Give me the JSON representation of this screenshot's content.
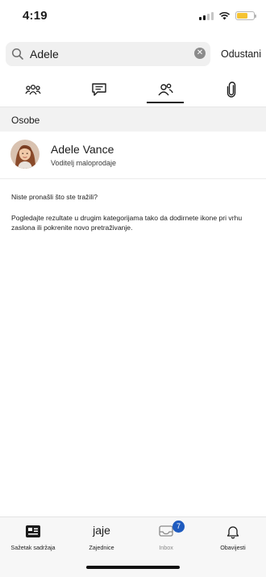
{
  "status_bar": {
    "time": "4:19"
  },
  "search": {
    "query": "Adele",
    "cancel_label": "Odustani"
  },
  "tabs": [
    {
      "icon": "people-group-icon",
      "selected": false
    },
    {
      "icon": "chat-icon",
      "selected": false
    },
    {
      "icon": "people-icon",
      "selected": true
    },
    {
      "icon": "paperclip-icon",
      "selected": false
    }
  ],
  "section": {
    "header": "Osobe"
  },
  "results": [
    {
      "name": "Adele Vance",
      "title": "Voditelj maloprodaje"
    }
  ],
  "empty_hint": {
    "question": "Niste pronašli što ste tražili?",
    "text": "Pogledajte rezultate u drugim kategorijama tako da dodirnete ikone pri vrhu zaslona ili pokrenite novo pretraživanje."
  },
  "bottom_nav": {
    "items": [
      {
        "label": "Sažetak sadržaja",
        "icon": "news-feed-icon"
      },
      {
        "label": "Zajednice",
        "icon_text": "jaje"
      },
      {
        "label": "Inbox",
        "icon": "inbox-icon",
        "badge": "7"
      },
      {
        "label": "Obavijesti",
        "icon": "bell-icon"
      }
    ]
  },
  "colors": {
    "accent": "#1f5bbf",
    "battery": "#f5c332"
  }
}
